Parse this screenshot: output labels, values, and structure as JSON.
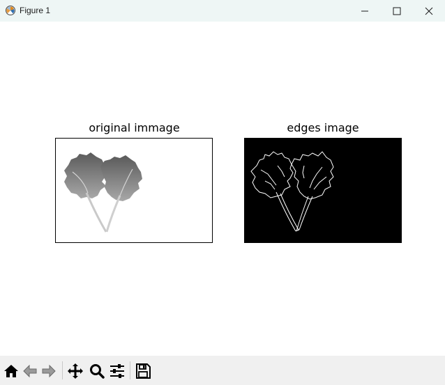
{
  "window": {
    "title": "Figure 1",
    "app_icon": "matplotlib-figure-icon",
    "controls": [
      "minimize-icon",
      "maximize-icon",
      "close-icon"
    ]
  },
  "figure": {
    "left_axes": {
      "title": "original immage",
      "image": "grayscale leaf photograph on white background"
    },
    "right_axes": {
      "title": "edges image",
      "image": "white edge outlines on black background"
    }
  },
  "toolbar": {
    "tools": [
      "home-icon",
      "back-icon",
      "forward-icon",
      "pan-icon",
      "zoom-icon",
      "configure-subplots-icon",
      "save-icon"
    ]
  }
}
